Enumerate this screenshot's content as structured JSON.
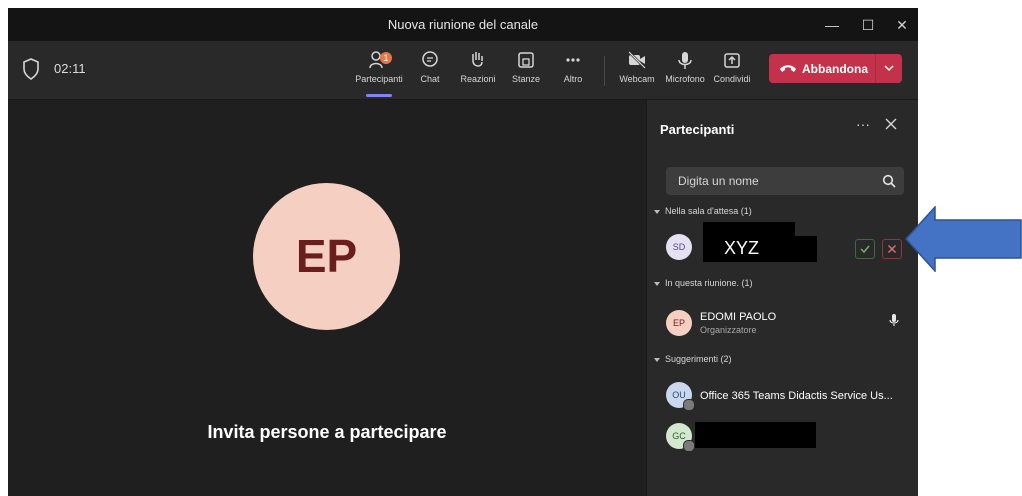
{
  "window": {
    "title": "Nuova riunione del canale"
  },
  "toolbar": {
    "timer": "02:11",
    "participants_label": "Partecipanti",
    "participants_badge": "1",
    "chat_label": "Chat",
    "reactions_label": "Reazioni",
    "rooms_label": "Stanze",
    "more_label": "Altro",
    "webcam_label": "Webcam",
    "mic_label": "Microfono",
    "share_label": "Condividi",
    "leave_label": "Abbandona"
  },
  "stage": {
    "avatar_initials": "EP",
    "invite_text": "Invita persone a partecipare"
  },
  "panel": {
    "title": "Partecipanti",
    "more": "···",
    "search_placeholder": "Digita un nome",
    "lobby": {
      "header": "Nella sala d'attesa (1)",
      "person": {
        "initials": "SD",
        "name": "XYZ"
      }
    },
    "in_meeting": {
      "header": "In questa riunione. (1)",
      "person": {
        "initials": "EP",
        "name": "EDOMI PAOLO",
        "role": "Organizzatore"
      }
    },
    "suggestions": {
      "header": "Suggerimenti (2)",
      "people": [
        {
          "initials": "OU",
          "name": "Office 365 Teams Didactis Service Us..."
        },
        {
          "initials": "GC",
          "name": ""
        }
      ]
    }
  },
  "colors": {
    "leave": "#c4314b",
    "accent": "#7f85f5",
    "arrow": "#4472c4",
    "badge": "#e97548"
  }
}
